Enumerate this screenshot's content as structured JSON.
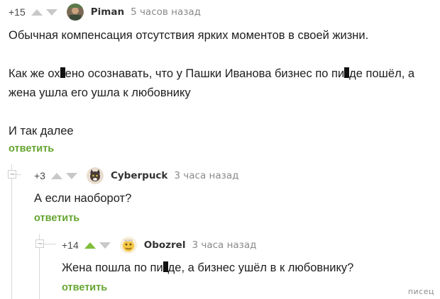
{
  "comments": [
    {
      "rating": "+15",
      "username": "Piman",
      "time": "5 часов назад",
      "text": {
        "line1": "Обычная компенсация отсутствия ярких моментов в своей жизни.",
        "line2_part1": "Как же ох",
        "line2_part2": "ено осознавать, что у Пашки Иванова бизнес по пи",
        "line2_part3": "де пошёл, а",
        "line3": "жена ушла его ушла к любовнику",
        "line4": "И так далее"
      },
      "reply_label": "ответить"
    },
    {
      "rating": "+3",
      "username": "Cyberpuck",
      "time": "3 часа назад",
      "text": "А если наоборот?",
      "reply_label": "ответить"
    },
    {
      "rating": "+14",
      "username": "Obozrel",
      "time": "3 часа назад",
      "text_part1": "Жена пошла по пи",
      "text_part2": "де, а бизнес ушёл в к любовнику?",
      "reply_label": "ответить",
      "upvoted": true
    }
  ],
  "watermark": "писец",
  "colors": {
    "reply_link": "#64a530",
    "upvote_active": "#7fbf3a",
    "arrow_inactive": "#c8c8c8",
    "branch_line": "#d8d8d8"
  }
}
